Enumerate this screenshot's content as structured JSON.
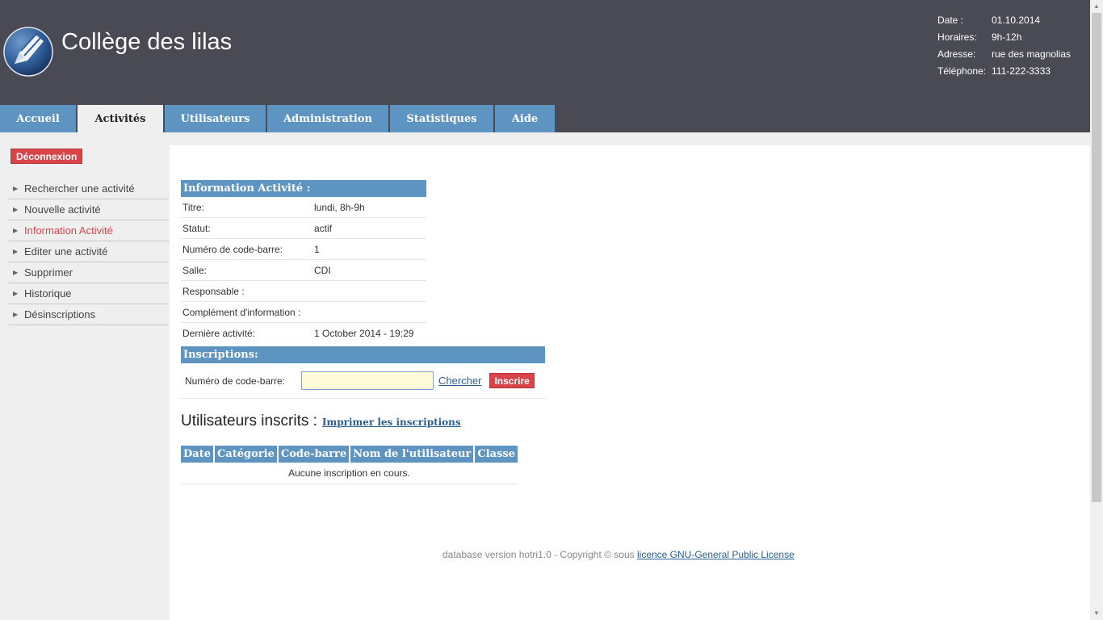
{
  "header": {
    "title": "Collège des lilas",
    "info": [
      {
        "label": "Date :",
        "value": "01.10.2014"
      },
      {
        "label": "Horaires:",
        "value": "9h-12h"
      },
      {
        "label": "Adresse:",
        "value": "rue des magnolias"
      },
      {
        "label": "Téléphone:",
        "value": "111-222-3333"
      }
    ]
  },
  "tabs": [
    {
      "label": "Accueil",
      "active": false
    },
    {
      "label": "Activités",
      "active": true
    },
    {
      "label": "Utilisateurs",
      "active": false
    },
    {
      "label": "Administration",
      "active": false
    },
    {
      "label": "Statistiques",
      "active": false
    },
    {
      "label": "Aide",
      "active": false
    }
  ],
  "sidebar": {
    "logout_label": "Déconnexion",
    "items": [
      {
        "label": "Rechercher une activité"
      },
      {
        "label": "Nouvelle activité"
      },
      {
        "label": "Information Activité",
        "active": true
      },
      {
        "label": "Editer une activité"
      },
      {
        "label": "Supprimer"
      },
      {
        "label": "Historique"
      },
      {
        "label": "Désinscriptions"
      }
    ]
  },
  "info_section": {
    "title": "Information Activité :",
    "rows": [
      {
        "label": "Titre:",
        "value": "lundi, 8h-9h"
      },
      {
        "label": "Statut:",
        "value": "actif"
      },
      {
        "label": "Numéro de code-barre:",
        "value": "1"
      },
      {
        "label": "Salle:",
        "value": "CDI"
      },
      {
        "label": "Responsable :",
        "value": ""
      },
      {
        "label": "Complément d'information :",
        "value": ""
      },
      {
        "label": "Dernière activité:",
        "value": "1 October 2014 - 19:29"
      }
    ]
  },
  "inscriptions": {
    "title": "Inscriptions:",
    "barcode_label": "Numéro de code-barre:",
    "barcode_value": "",
    "search_label": "Chercher",
    "register_label": "Inscrire"
  },
  "users": {
    "title": "Utilisateurs inscrits :",
    "print_label": "Imprimer les inscriptions",
    "columns": [
      "Date",
      "Catégorie",
      "Code-barre",
      "Nom de l'utilisateur",
      "Classe"
    ],
    "empty_message": "Aucune inscription en cours."
  },
  "footer": {
    "text": "database version hotri1.0 - Copyright © sous",
    "link_label": "licence GNU-General Public License"
  },
  "colors": {
    "header_bg": "#4a4a54",
    "tab_blue": "#5d94c1",
    "accent_red": "#d9434a",
    "link_blue": "#2a5f91"
  }
}
